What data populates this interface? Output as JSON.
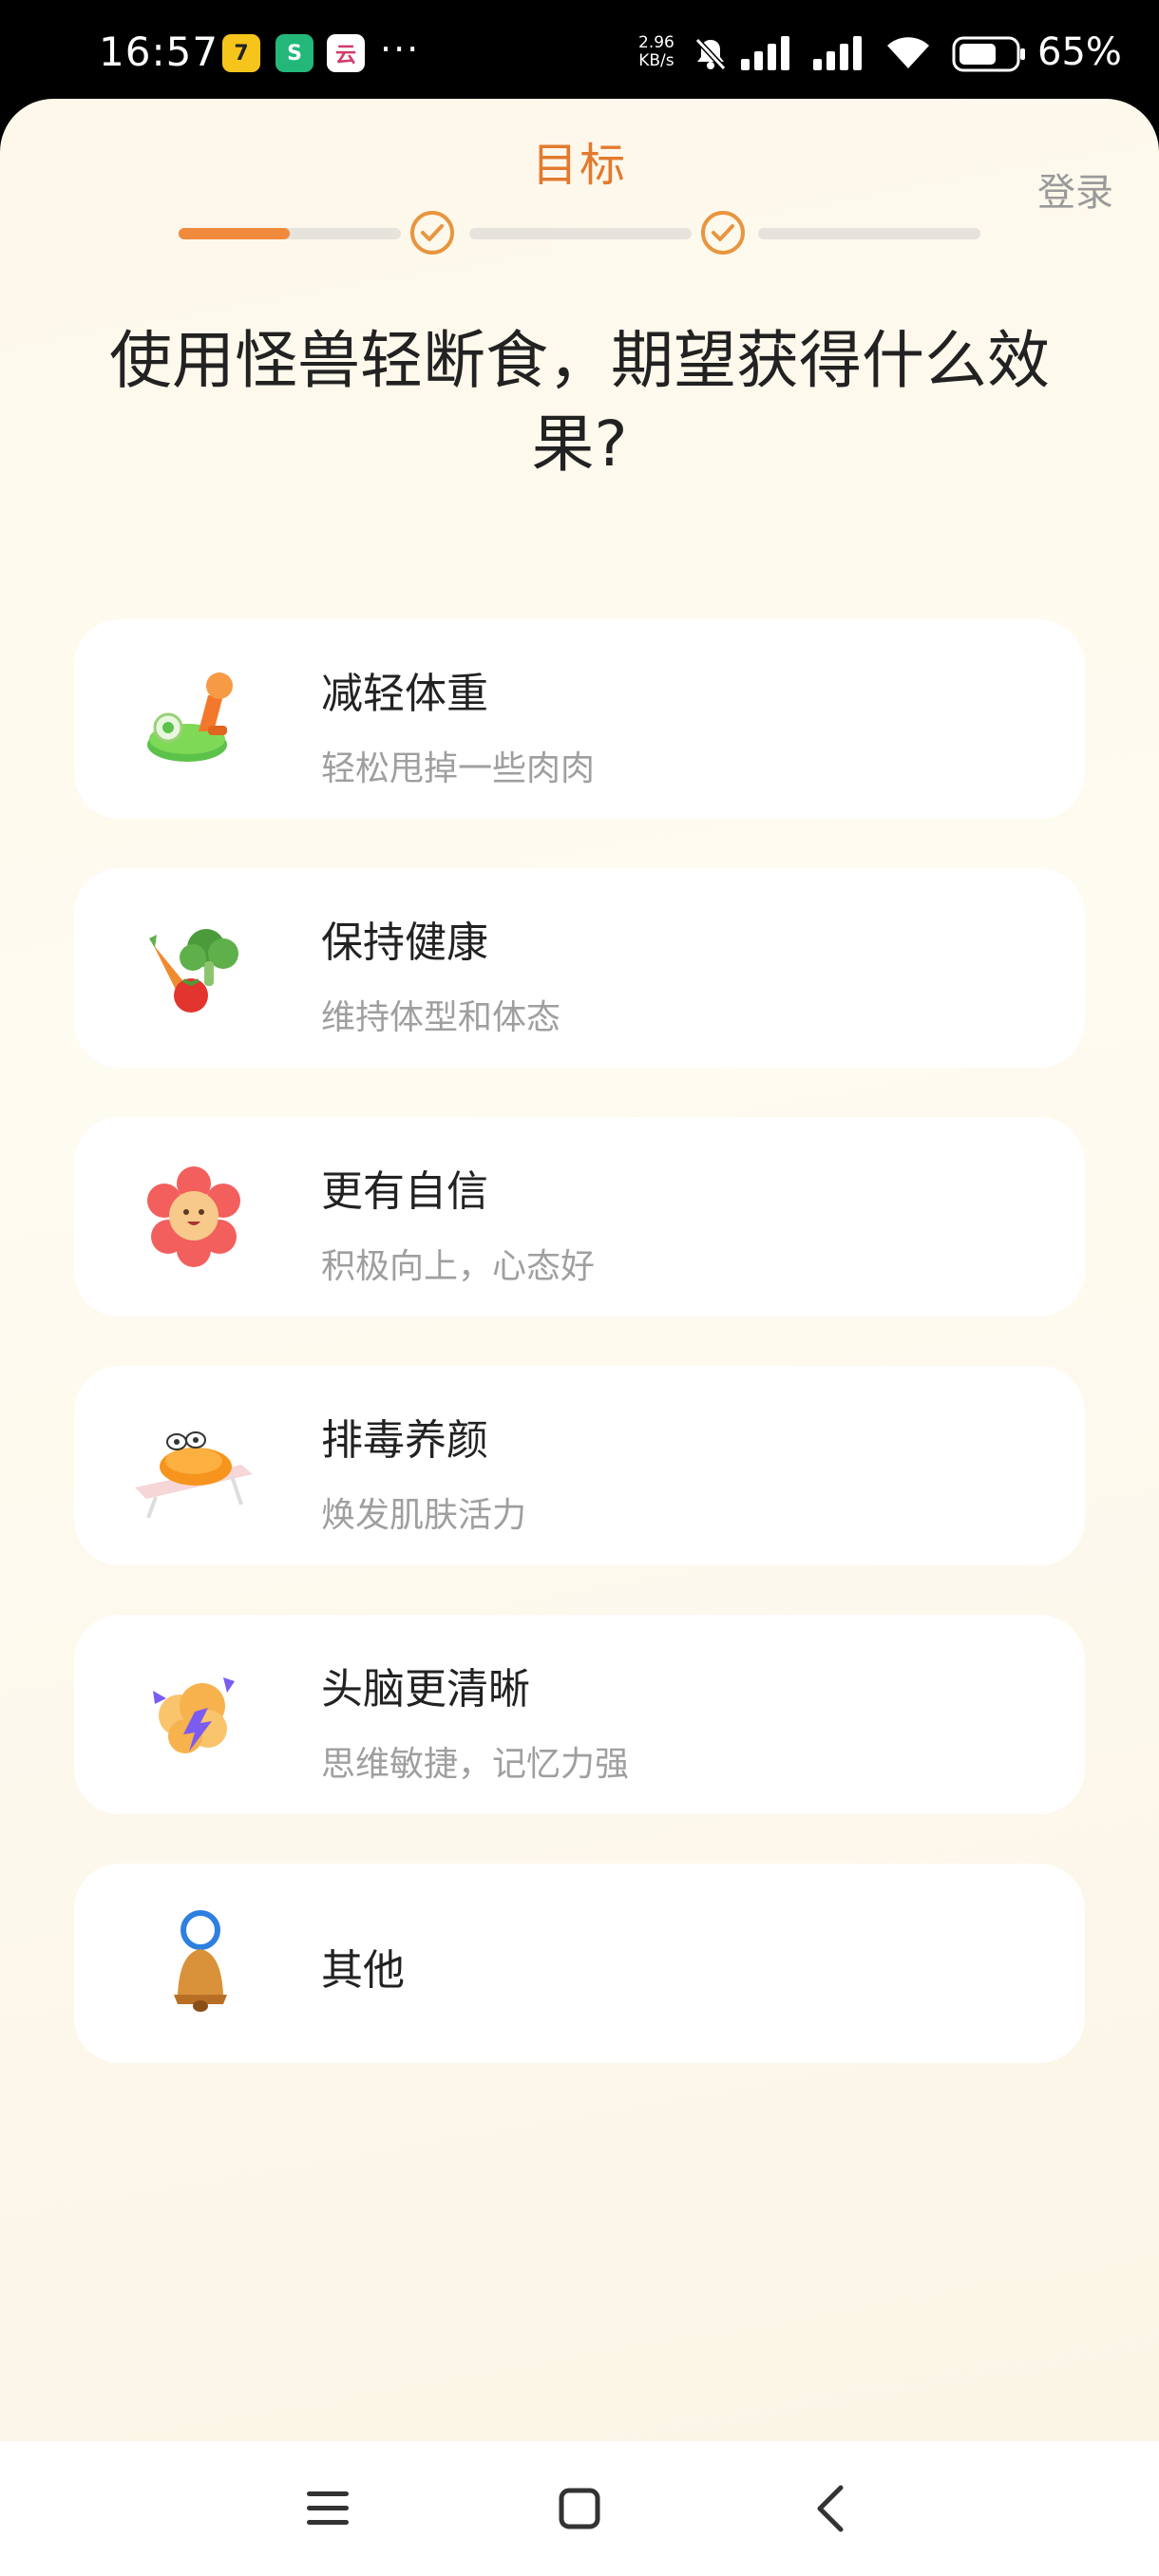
{
  "status_bar": {
    "time": "16:57",
    "app_icons": [
      "7",
      "S",
      "云"
    ],
    "more": "···",
    "net_speed_value": "2.96",
    "net_speed_unit": "KB/s",
    "battery": "65%"
  },
  "header": {
    "step_title": "目标",
    "login": "登录",
    "progress": {
      "segment_count": 3,
      "current_fill_fraction": 0.5,
      "completed_checks": 2
    }
  },
  "question": "使用怪兽轻断食，期望获得什么效果?",
  "options": [
    {
      "title": "减轻体重",
      "subtitle": "轻松甩掉一些肉肉",
      "icon": "scale-icon"
    },
    {
      "title": "保持健康",
      "subtitle": "维持体型和体态",
      "icon": "vegetables-icon"
    },
    {
      "title": "更有自信",
      "subtitle": "积极向上，心态好",
      "icon": "flower-icon"
    },
    {
      "title": "排毒养颜",
      "subtitle": "焕发肌肤活力",
      "icon": "sunbathing-icon"
    },
    {
      "title": "头脑更清晰",
      "subtitle": "思维敏捷，记忆力强",
      "icon": "brain-icon"
    },
    {
      "title": "其他",
      "subtitle": "",
      "icon": "bell-icon"
    }
  ],
  "colors": {
    "accent": "#e37a2f",
    "progress_fill": "#f08b3d",
    "card_bg": "#ffffff",
    "page_bg": "#fdf8ea"
  }
}
